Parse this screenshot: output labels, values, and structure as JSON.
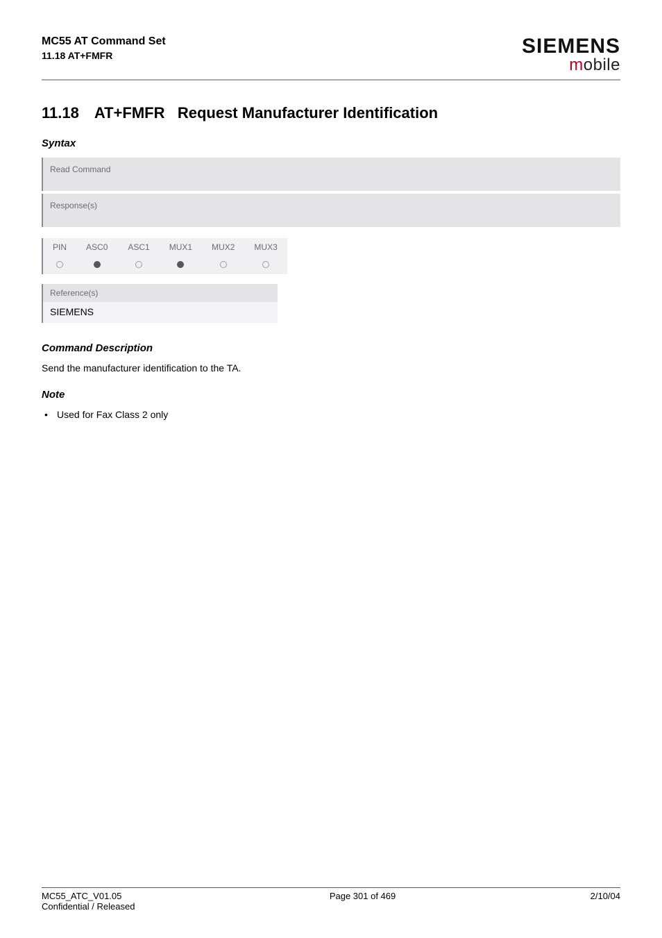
{
  "header": {
    "title_line1": "MC55 AT Command Set",
    "title_line2": "11.18 AT+FMFR",
    "brand_main": "SIEMENS",
    "brand_sub_prefix": "m",
    "brand_sub_rest": "obile"
  },
  "section": {
    "number": "11.18",
    "command": "AT+FMFR",
    "title": "Request Manufacturer Identification"
  },
  "syntax": {
    "heading": "Syntax",
    "read_command_label": "Read Command",
    "response_label": "Response(s)"
  },
  "indicators": {
    "headers": [
      "PIN",
      "ASC0",
      "ASC1",
      "MUX1",
      "MUX2",
      "MUX3"
    ],
    "values": [
      "empty",
      "filled",
      "empty",
      "filled",
      "empty",
      "empty"
    ]
  },
  "reference": {
    "label": "Reference(s)",
    "value": "SIEMENS"
  },
  "command_description": {
    "heading": "Command Description",
    "text": "Send the manufacturer identification to the TA."
  },
  "note": {
    "heading": "Note",
    "items": [
      "Used for Fax Class 2 only"
    ]
  },
  "footer": {
    "left_line1": "MC55_ATC_V01.05",
    "left_line2": "Confidential / Released",
    "center": "Page 301 of 469",
    "right": "2/10/04"
  }
}
